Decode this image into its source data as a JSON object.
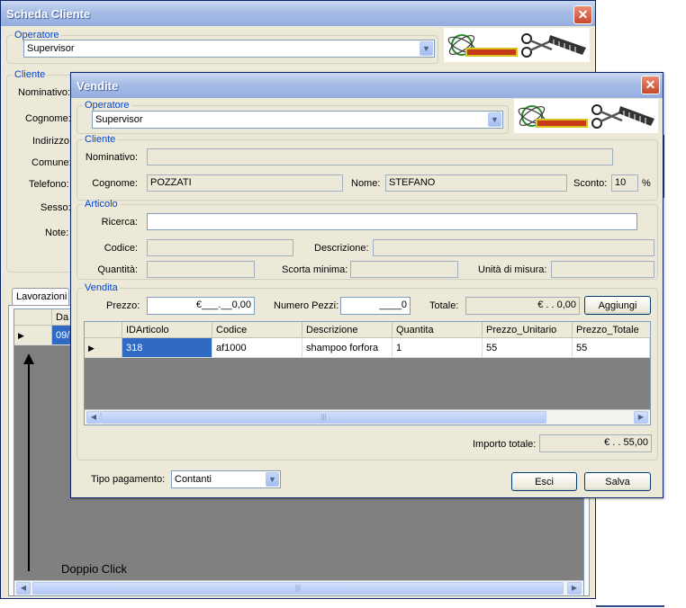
{
  "back_window": {
    "title": "Scheda Cliente",
    "close": "✕",
    "operatore": {
      "legend": "Operatore",
      "value": "Supervisor"
    },
    "cliente": {
      "legend": "Cliente",
      "labels": [
        "Nominativo:",
        "Cognome:",
        "Indirizzo:",
        "Comune:",
        "Telefono:",
        "Sesso:",
        "Note:"
      ]
    },
    "tab_label": "Lavorazioni",
    "grid": {
      "header": "Da",
      "row_value": "09/"
    },
    "scroll_thumb": "|||",
    "annotation": "Doppio Click"
  },
  "front_window": {
    "title": "Vendite",
    "close": "✕",
    "operatore": {
      "legend": "Operatore",
      "value": "Supervisor"
    },
    "cliente": {
      "legend": "Cliente",
      "nominativo_label": "Nominativo:",
      "nominativo_value": "",
      "cognome_label": "Cognome:",
      "cognome_value": "POZZATI",
      "nome_label": "Nome:",
      "nome_value": "STEFANO",
      "sconto_label": "Sconto:",
      "sconto_value": "10",
      "percent": "%"
    },
    "articolo": {
      "legend": "Articolo",
      "ricerca_label": "Ricerca:",
      "ricerca_value": "",
      "codice_label": "Codice:",
      "descrizione_label": "Descrizione:",
      "quantita_label": "Quantità:",
      "scorta_label": "Scorta minima:",
      "unita_label": "Unità di misura:"
    },
    "vendita": {
      "legend": "Vendita",
      "prezzo_label": "Prezzo:",
      "prezzo_value": "€___.__0,00",
      "numero_pezzi_label": "Numero Pezzi:",
      "numero_pezzi_value": "____0",
      "totale_label": "Totale:",
      "totale_value": "€ .  . 0,00",
      "aggiungi": "Aggiungi",
      "grid": {
        "columns": [
          "IDArticolo",
          "Codice",
          "Descrizione",
          "Quantita",
          "Prezzo_Unitario",
          "Prezzo_Totale"
        ],
        "rows": [
          {
            "IDArticolo": "318",
            "Codice": "af1000",
            "Descrizione": "shampoo forfora",
            "Quantita": "1",
            "Prezzo_Unitario": "55",
            "Prezzo_Totale": "55"
          }
        ]
      },
      "importo_label": "Importo totale:",
      "importo_value": "€ .  . 55,00"
    },
    "tipo_pagamento_label": "Tipo pagamento:",
    "tipo_pagamento_value": "Contanti",
    "esci": "Esci",
    "salva": "Salva",
    "scroll_thumb": "|||"
  },
  "icons": {
    "dropdown": "▼",
    "row_pointer": "▶",
    "scroll_left": "◀",
    "scroll_right": "▶",
    "logo": "hairdresser-logo-icon"
  },
  "colors": {
    "selection": "#316ac5",
    "legend": "#0046d5",
    "window_bg": "#ece9d8"
  }
}
